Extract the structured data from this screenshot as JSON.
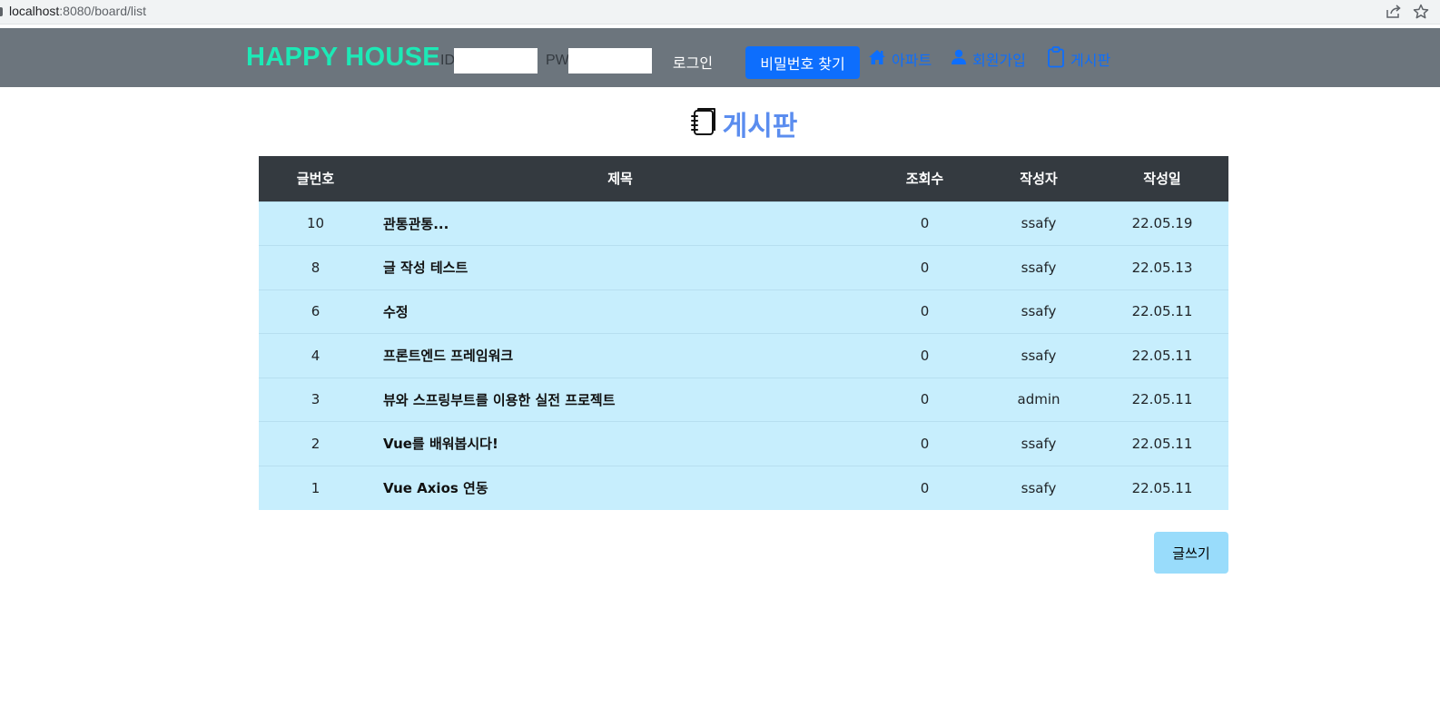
{
  "browser": {
    "url_host": "localhost",
    "url_rest": ":8080/board/list",
    "icons": [
      "share-icon",
      "star-icon"
    ]
  },
  "navbar": {
    "brand": "HAPPY HOUSE",
    "id_label": "ID",
    "pw_label": "PW",
    "id_value": "",
    "pw_value": "",
    "login_label": "로그인",
    "find_password_label": "비밀번호 찾기",
    "links": [
      {
        "label": "아파트",
        "icon": "home-icon"
      },
      {
        "label": "회원가입",
        "icon": "user-icon"
      },
      {
        "label": "게시판",
        "icon": "clipboard-icon"
      }
    ],
    "colors": {
      "background": "#6c757d",
      "brand": "#1de9b6",
      "primary": "#0d6efd"
    }
  },
  "page": {
    "title": "게시판",
    "title_icon": "journal-icon",
    "title_color": "#5b8def"
  },
  "table": {
    "headers": [
      "글번호",
      "제목",
      "조회수",
      "작성자",
      "작성일"
    ],
    "rows": [
      {
        "no": "10",
        "subject": "관통관통...",
        "hit": "0",
        "writer": "ssafy",
        "date": "22.05.19"
      },
      {
        "no": "8",
        "subject": "글 작성 테스트",
        "hit": "0",
        "writer": "ssafy",
        "date": "22.05.13"
      },
      {
        "no": "6",
        "subject": "수정",
        "hit": "0",
        "writer": "ssafy",
        "date": "22.05.11"
      },
      {
        "no": "4",
        "subject": "프론트엔드 프레임워크",
        "hit": "0",
        "writer": "ssafy",
        "date": "22.05.11"
      },
      {
        "no": "3",
        "subject": "뷰와 스프링부트를 이용한 실전 프로젝트",
        "hit": "0",
        "writer": "admin",
        "date": "22.05.11"
      },
      {
        "no": "2",
        "subject": "Vue를 배워봅시다!",
        "hit": "0",
        "writer": "ssafy",
        "date": "22.05.11"
      },
      {
        "no": "1",
        "subject": "Vue Axios 연동",
        "hit": "0",
        "writer": "ssafy",
        "date": "22.05.11"
      }
    ],
    "colors": {
      "header_bg": "#343a40",
      "row_bg": "#c7eefd"
    }
  },
  "actions": {
    "write_label": "글쓰기",
    "write_color": "#99dcfb"
  }
}
